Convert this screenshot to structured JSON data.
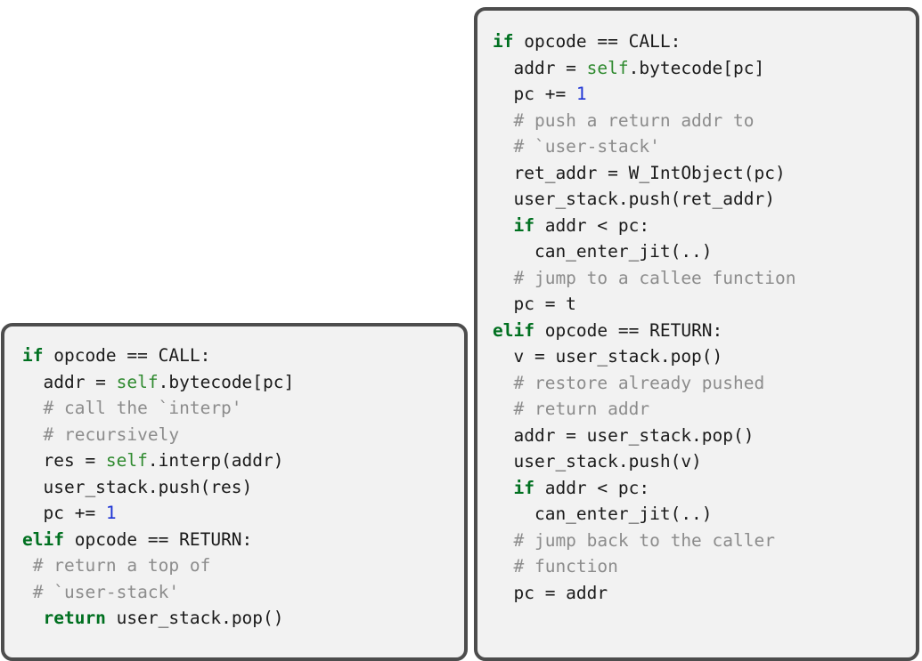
{
  "colors": {
    "keyword": "#007020",
    "self": "#2f8a2f",
    "number": "#1c32d4",
    "comment": "#8c8c8c",
    "text": "#1a1a1a",
    "panel_background": "#f2f2f2",
    "panel_border": "#4d4d4d"
  },
  "panels": [
    {
      "id": "left",
      "lines": [
        [
          {
            "k": "keyword",
            "t": "if"
          },
          {
            "k": "text",
            "t": " opcode == CALL:"
          }
        ],
        [
          {
            "k": "text",
            "t": "  addr = "
          },
          {
            "k": "self",
            "t": "self"
          },
          {
            "k": "text",
            "t": ".bytecode[pc]"
          }
        ],
        [
          {
            "k": "comment",
            "t": "  # call the `interp'"
          }
        ],
        [
          {
            "k": "comment",
            "t": "  # recursively"
          }
        ],
        [
          {
            "k": "text",
            "t": "  res = "
          },
          {
            "k": "self",
            "t": "self"
          },
          {
            "k": "text",
            "t": ".interp(addr)"
          }
        ],
        [
          {
            "k": "text",
            "t": "  user_stack.push(res)"
          }
        ],
        [
          {
            "k": "text",
            "t": "  pc += "
          },
          {
            "k": "number",
            "t": "1"
          }
        ],
        [
          {
            "k": "keyword",
            "t": "elif"
          },
          {
            "k": "text",
            "t": " opcode == RETURN:"
          }
        ],
        [
          {
            "k": "comment",
            "t": " # return a top of"
          }
        ],
        [
          {
            "k": "comment",
            "t": " # `user-stack'"
          }
        ],
        [
          {
            "k": "text",
            "t": "  "
          },
          {
            "k": "keyword",
            "t": "return"
          },
          {
            "k": "text",
            "t": " user_stack.pop()"
          }
        ]
      ]
    },
    {
      "id": "right",
      "lines": [
        [
          {
            "k": "keyword",
            "t": "if"
          },
          {
            "k": "text",
            "t": " opcode == CALL:"
          }
        ],
        [
          {
            "k": "text",
            "t": "  addr = "
          },
          {
            "k": "self",
            "t": "self"
          },
          {
            "k": "text",
            "t": ".bytecode[pc]"
          }
        ],
        [
          {
            "k": "text",
            "t": "  pc += "
          },
          {
            "k": "number",
            "t": "1"
          }
        ],
        [
          {
            "k": "comment",
            "t": "  # push a return addr to"
          }
        ],
        [
          {
            "k": "comment",
            "t": "  # `user-stack'"
          }
        ],
        [
          {
            "k": "text",
            "t": "  ret_addr = W_IntObject(pc)"
          }
        ],
        [
          {
            "k": "text",
            "t": "  user_stack.push(ret_addr)"
          }
        ],
        [
          {
            "k": "text",
            "t": "  "
          },
          {
            "k": "keyword",
            "t": "if"
          },
          {
            "k": "text",
            "t": " addr < pc:"
          }
        ],
        [
          {
            "k": "text",
            "t": "    can_enter_jit(..)"
          }
        ],
        [
          {
            "k": "comment",
            "t": "  # jump to a callee function"
          }
        ],
        [
          {
            "k": "text",
            "t": "  pc = t"
          }
        ],
        [
          {
            "k": "keyword",
            "t": "elif"
          },
          {
            "k": "text",
            "t": " opcode == RETURN:"
          }
        ],
        [
          {
            "k": "text",
            "t": "  v = user_stack.pop()"
          }
        ],
        [
          {
            "k": "comment",
            "t": "  # restore already pushed"
          }
        ],
        [
          {
            "k": "comment",
            "t": "  # return addr"
          }
        ],
        [
          {
            "k": "text",
            "t": "  addr = user_stack.pop()"
          }
        ],
        [
          {
            "k": "text",
            "t": "  user_stack.push(v)"
          }
        ],
        [
          {
            "k": "text",
            "t": "  "
          },
          {
            "k": "keyword",
            "t": "if"
          },
          {
            "k": "text",
            "t": " addr < pc:"
          }
        ],
        [
          {
            "k": "text",
            "t": "    can_enter_jit(..)"
          }
        ],
        [
          {
            "k": "comment",
            "t": "  # jump back to the caller"
          }
        ],
        [
          {
            "k": "comment",
            "t": "  # function"
          }
        ],
        [
          {
            "k": "text",
            "t": "  pc = addr"
          }
        ]
      ]
    }
  ]
}
